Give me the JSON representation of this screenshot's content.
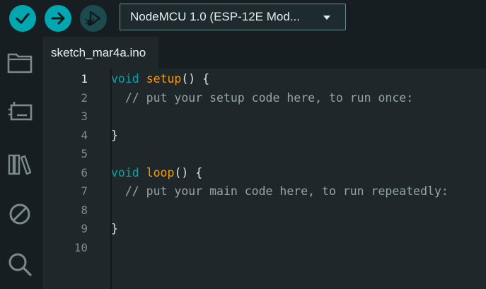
{
  "toolbar": {
    "board": "NodeMCU 1.0 (ESP-12E Mod..."
  },
  "tabs": [
    {
      "label": "sketch_mar4a.ino"
    }
  ],
  "editor": {
    "line_numbers": [
      "1",
      "2",
      "3",
      "4",
      "5",
      "6",
      "7",
      "8",
      "9",
      "10"
    ],
    "lines": [
      [
        {
          "t": "void",
          "c": "kw"
        },
        {
          "t": " ",
          "c": ""
        },
        {
          "t": "setup",
          "c": "fn"
        },
        {
          "t": "() {",
          "c": ""
        }
      ],
      [
        {
          "t": "  // put your setup code here, to run once:",
          "c": "cm"
        }
      ],
      [],
      [
        {
          "t": "}",
          "c": ""
        }
      ],
      [],
      [
        {
          "t": "void",
          "c": "kw"
        },
        {
          "t": " ",
          "c": ""
        },
        {
          "t": "loop",
          "c": "fn"
        },
        {
          "t": "() {",
          "c": ""
        }
      ],
      [
        {
          "t": "  // put your main code here, to run repeatedly:",
          "c": "cm"
        }
      ],
      [],
      [
        {
          "t": "}",
          "c": ""
        }
      ],
      []
    ]
  },
  "colors": {
    "accent": "#00a7b0",
    "background": "#171e21",
    "editor_bg": "#1f272a",
    "keyword": "#0ca1a6",
    "function": "#f39c12",
    "comment": "#95a5a6"
  },
  "icons": {
    "verify": "check-icon",
    "upload": "arrow-right-icon",
    "debug": "debug-icon",
    "sketchbook": "folder-icon",
    "boards": "board-manager-icon",
    "library": "library-icon",
    "debugger": "no-entry-icon",
    "search": "search-icon"
  }
}
